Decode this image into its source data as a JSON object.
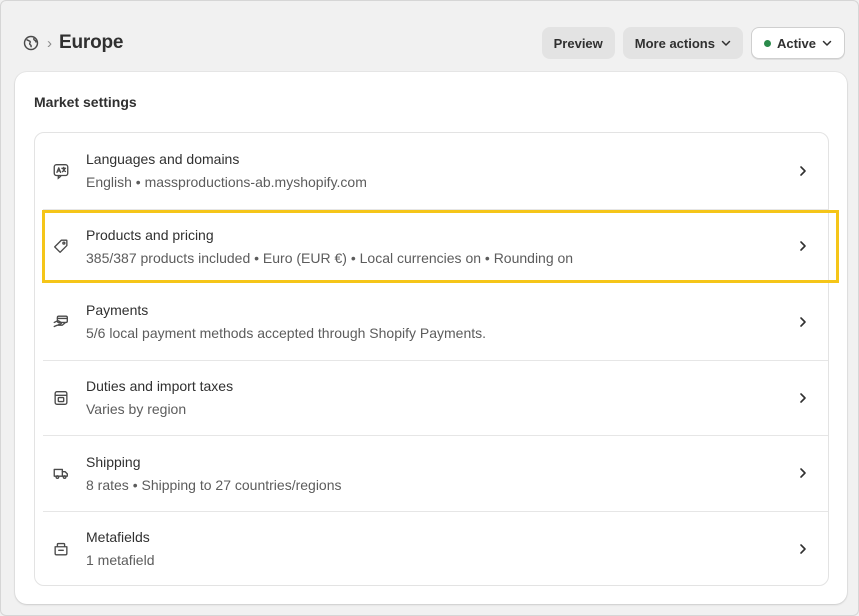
{
  "header": {
    "breadcrumb_icon": "globe-icon",
    "breadcrumb_separator": "›",
    "title": "Europe",
    "preview_label": "Preview",
    "more_actions_label": "More actions",
    "status_label": "Active",
    "status_color": "#2a8a4a"
  },
  "card": {
    "title": "Market settings",
    "rows": [
      {
        "icon": "translate-icon",
        "title": "Languages and domains",
        "subtitle": "English • massproductions-ab.myshopify.com"
      },
      {
        "icon": "price-tag-icon",
        "title": "Products and pricing",
        "subtitle": "385/387 products included • Euro (EUR €) • Local currencies on • Rounding on"
      },
      {
        "icon": "payment-hand-icon",
        "title": "Payments",
        "subtitle": "5/6 local payment methods accepted through Shopify Payments."
      },
      {
        "icon": "receipt-tax-icon",
        "title": "Duties and import taxes",
        "subtitle": "Varies by region"
      },
      {
        "icon": "delivery-truck-icon",
        "title": "Shipping",
        "subtitle": "8 rates • Shipping to 27 countries/regions"
      },
      {
        "icon": "metafield-icon",
        "title": "Metafields",
        "subtitle": "1 metafield"
      }
    ]
  },
  "highlight_color": "#f5c518"
}
